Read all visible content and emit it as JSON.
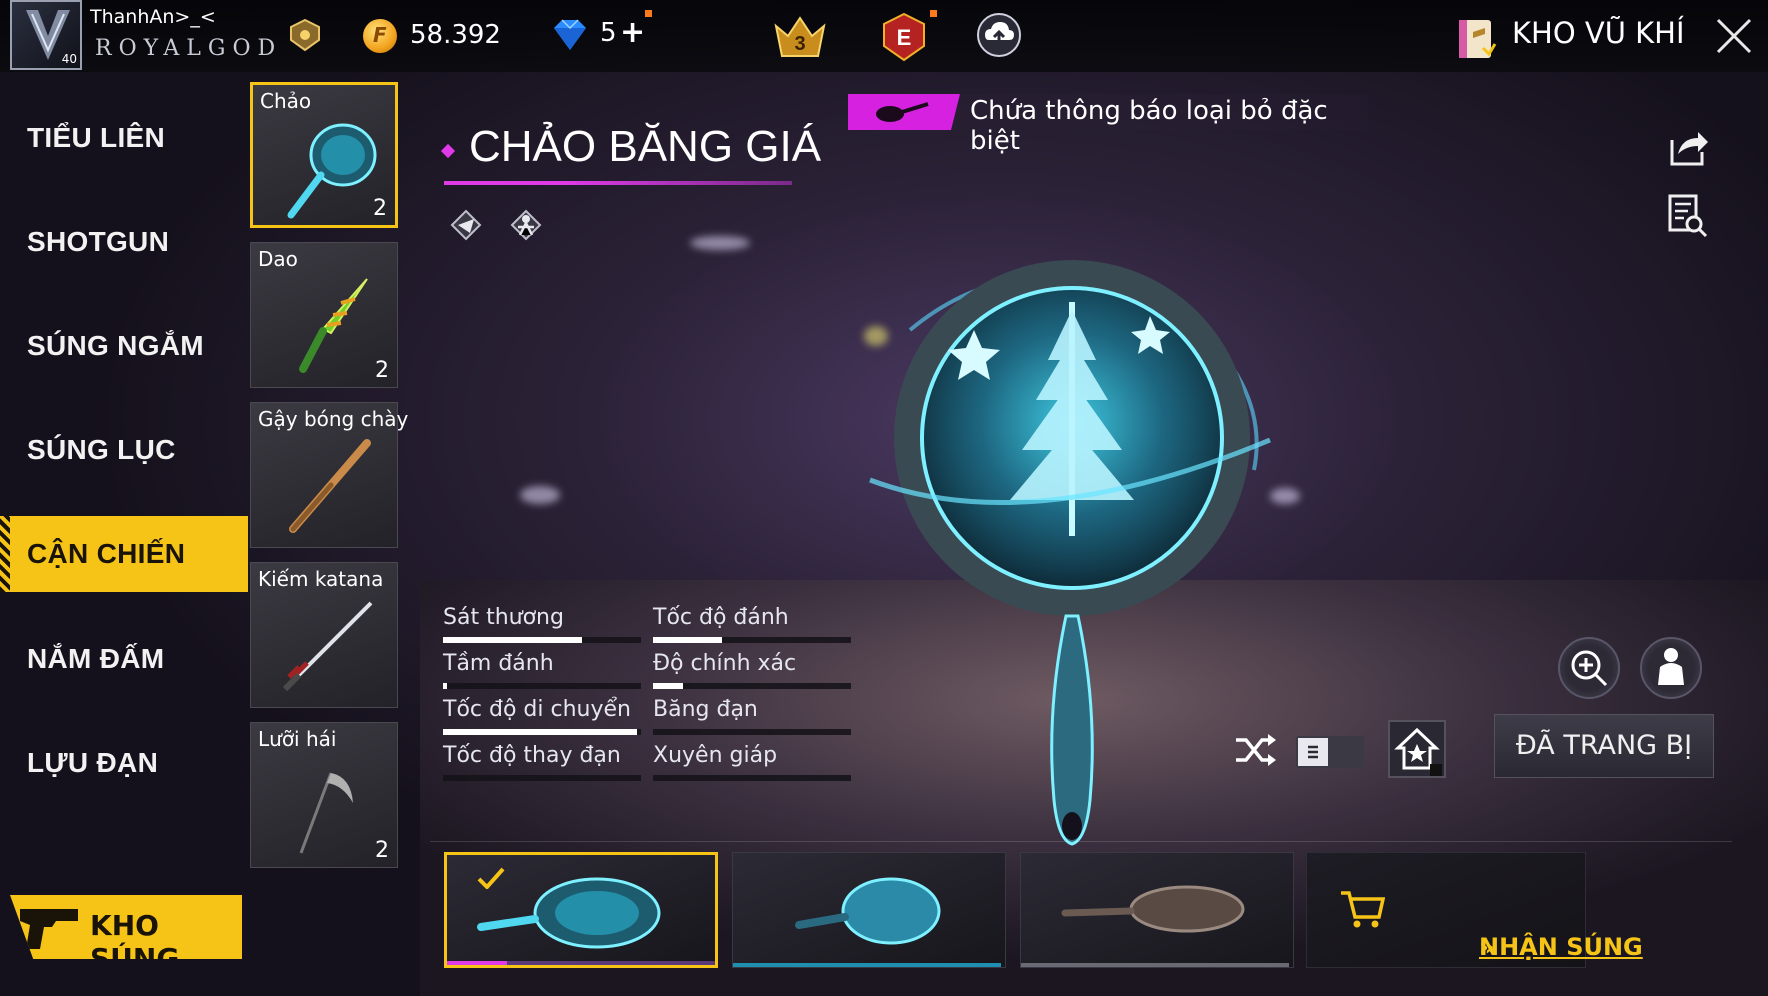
{
  "topbar": {
    "nickname": "ThanhAn>_<",
    "rank_title": "ROYALGOD",
    "level": "40",
    "coins": "58.392",
    "diamonds": "5",
    "diamond_plus": "+",
    "event_badge_number": "3",
    "event_letter": "E",
    "armory_label": "KHO VŨ KHÍ"
  },
  "categories": [
    {
      "label": "TIỂU LIÊN",
      "active": false
    },
    {
      "label": "SHOTGUN",
      "active": false
    },
    {
      "label": "SÚNG NGẮM",
      "active": false
    },
    {
      "label": "SÚNG LỤC",
      "active": false
    },
    {
      "label": "CẬN CHIẾN",
      "active": true
    },
    {
      "label": "NẮM ĐẤM",
      "active": false
    },
    {
      "label": "LỰU ĐẠN",
      "active": false
    }
  ],
  "kho_sung_label": "KHO SÚNG",
  "weapons": [
    {
      "name": "Chảo",
      "count": "2"
    },
    {
      "name": "Dao",
      "count": "2"
    },
    {
      "name": "Gậy bóng chày",
      "count": ""
    },
    {
      "name": "Kiếm katana",
      "count": ""
    },
    {
      "name": "Lưỡi hái",
      "count": "2"
    }
  ],
  "notice_text": "Chứa thông báo loại bỏ đặc biệt",
  "weapon_title": "CHẢO BĂNG GIÁ",
  "stats": [
    {
      "label": "Sát thương",
      "value": 0.7
    },
    {
      "label": "Tốc độ đánh",
      "value": 0.35
    },
    {
      "label": "Tầm đánh",
      "value": 0.02
    },
    {
      "label": "Độ chính xác",
      "value": 0.15
    },
    {
      "label": "Tốc độ di chuyển",
      "value": 0.98
    },
    {
      "label": "Băng đạn",
      "value": 0
    },
    {
      "label": "Tốc độ thay đạn",
      "value": 0
    },
    {
      "label": "Xuyên giáp",
      "value": 0
    }
  ],
  "equip_label": "ĐÃ TRANG BỊ",
  "get_gun_label": "NHẬN SÚNG",
  "get_gun_arrows": "»",
  "colors": {
    "accent_yellow": "#f6c417",
    "accent_magenta": "#e03ae8",
    "ice_cyan": "#3fd6f0"
  }
}
